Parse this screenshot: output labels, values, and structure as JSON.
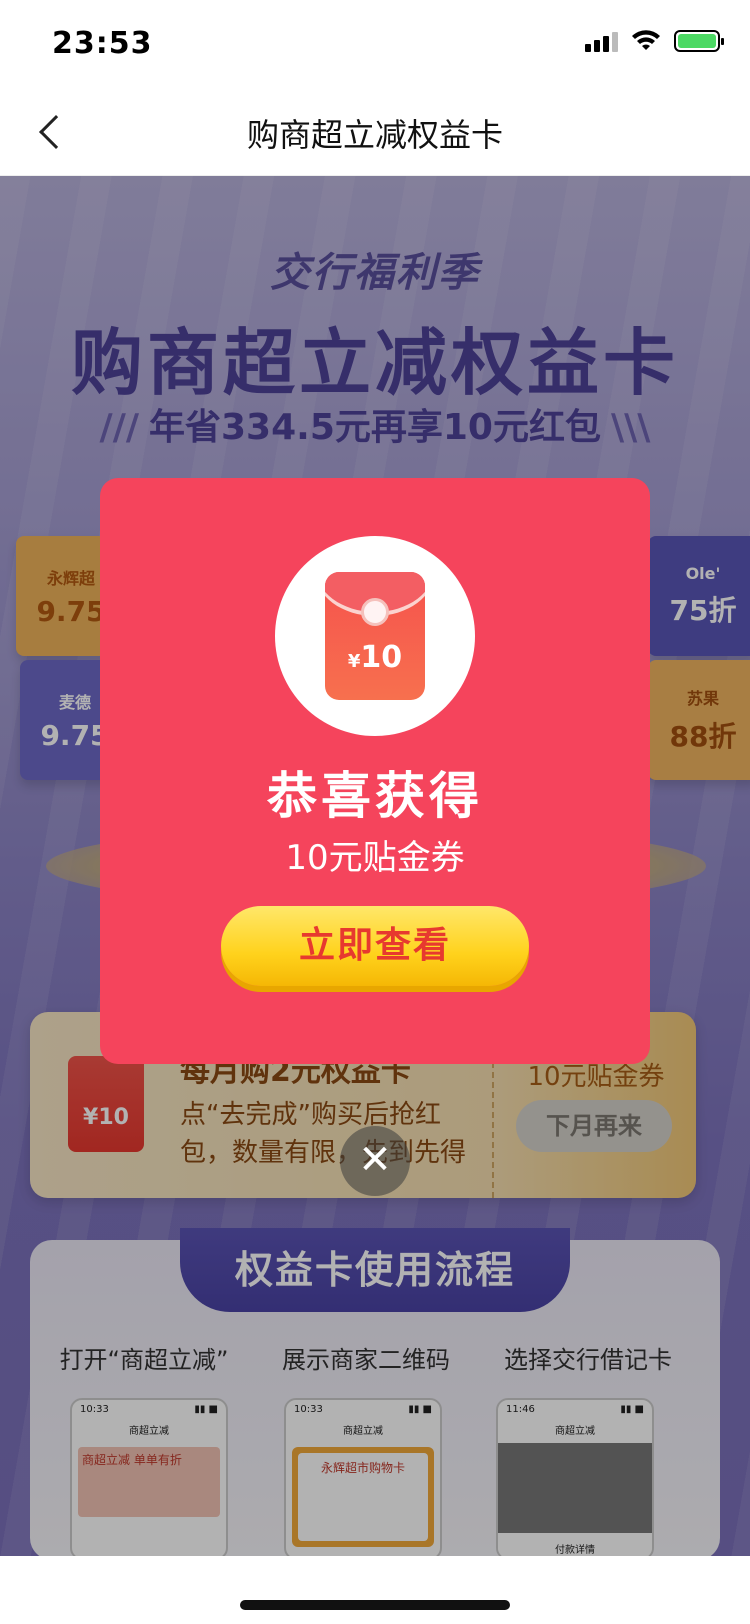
{
  "status_bar": {
    "time": "23:53"
  },
  "nav": {
    "title": "购商超立减权益卡"
  },
  "hero": {
    "subtitle": "交行福利季",
    "title": "购商超立减权益卡",
    "tagline": "年省334.5元再享10元红包"
  },
  "brands": [
    {
      "name": "永辉超",
      "value": "9.75"
    },
    {
      "name": "麦德",
      "value": "9.75"
    },
    {
      "name": "Ole'",
      "value": "75折"
    },
    {
      "name": "苏果",
      "value": "88折"
    }
  ],
  "offer": {
    "envelope_amount": "¥10",
    "title": "每月购2元权益卡",
    "description": "点“去完成”购买后抢红包，数量有限，先到先得",
    "coupon": "10元贴金券",
    "button": "下月再来"
  },
  "process": {
    "heading": "权益卡使用流程",
    "steps": [
      {
        "label": "打开“商超立减”",
        "phone_time": "10:33",
        "phone_title": "商超立减",
        "phone_text": "商超立减 单单有折"
      },
      {
        "label": "展示商家二维码",
        "phone_time": "10:33",
        "phone_title": "商超立减",
        "phone_text": "永辉超市购物卡"
      },
      {
        "label": "选择交行借记卡",
        "phone_time": "11:46",
        "phone_title": "商超立减",
        "phone_text": "付款详情"
      }
    ]
  },
  "modal": {
    "envelope_currency": "¥",
    "envelope_value": "10",
    "title": "恭喜获得",
    "description": "10元贴金券",
    "button": "立即查看",
    "close_symbol": "✕"
  },
  "colors": {
    "modal_bg": "#f5445c",
    "button_yellow": "#ffd21c",
    "button_text": "#e7392f",
    "brand_purple": "#4e4298"
  }
}
